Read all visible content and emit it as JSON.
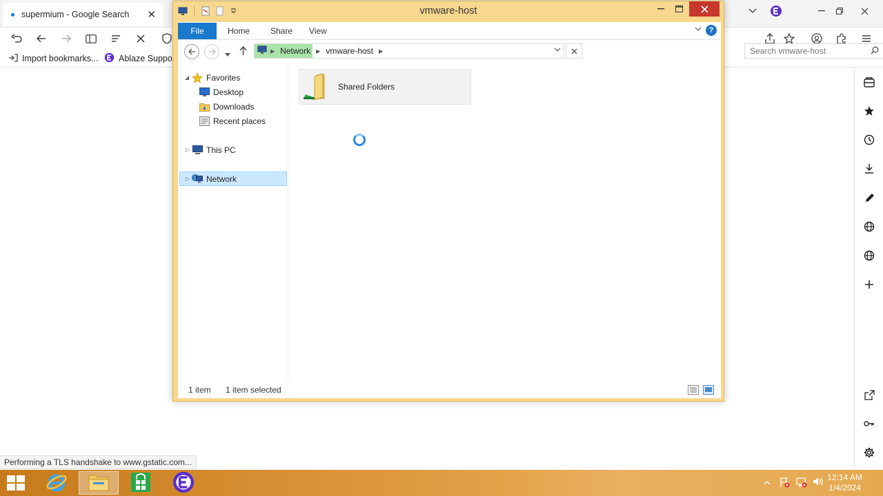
{
  "browser": {
    "tab_title": "supermium - Google Search",
    "tab_close": "✕",
    "bookmarks": [
      {
        "label": "Import bookmarks..."
      },
      {
        "label": "Ablaze Support"
      }
    ],
    "status_text": "Performing a TLS handshake to www.gstatic.com..."
  },
  "explorer": {
    "window_title": "vmware-host",
    "ribbon_tabs": [
      "File",
      "Home",
      "Share",
      "View"
    ],
    "breadcrumb": [
      "Network",
      "vmware-host"
    ],
    "search_placeholder": "Search vmware-host",
    "nav": {
      "favorites": "Favorites",
      "favorites_items": [
        "Desktop",
        "Downloads",
        "Recent places"
      ],
      "this_pc": "This PC",
      "network": "Network"
    },
    "items": [
      {
        "name": "Shared Folders"
      }
    ],
    "status_count": "1 item",
    "status_selected": "1 item selected"
  },
  "taskbar": {
    "time": "12:14 AM",
    "date": "1/4/2024"
  },
  "colors": {
    "window_frame": "#f8d88f",
    "ribbon_file": "#1979ca",
    "nav_selected": "#cce8ff",
    "address_highlight": "#a9e3a9",
    "taskbar_orange": "#e3a046",
    "close_button": "#c7372c"
  }
}
